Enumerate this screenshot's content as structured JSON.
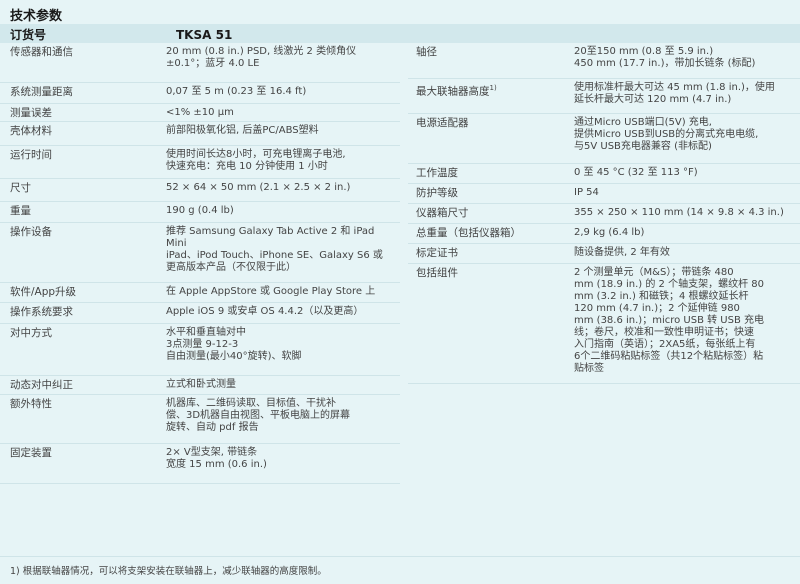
{
  "title": "技术参数",
  "header": {
    "key": "订货号",
    "value": "TKSA 51"
  },
  "left": [
    {
      "k": "传感器和通信",
      "v": "20 mm (0.8 in.) PSD, 线激光 2 类倾角仪\n±0.1°；蓝牙 4.0 LE",
      "h": 40
    },
    {
      "k": "系统测量距离",
      "v": "0,07 至 5 m (0.23 至 16.4 ft)",
      "h": 21
    },
    {
      "k": "测量误差",
      "v": "<1% ±10 µm",
      "h": 18
    },
    {
      "k": "壳体材料",
      "v": "前部阳极氧化铝, 后盖PC/ABS塑料",
      "h": 24
    },
    {
      "k": "运行时间",
      "v": "使用时间长达8小时，可充电锂离子电池,\n快速充电：充电 10 分钟使用 1 小时",
      "h": 33
    },
    {
      "k": "尺寸",
      "v": "52 × 64 × 50 mm (2.1 × 2.5 × 2 in.)",
      "h": 23
    },
    {
      "k": "重量",
      "v": "190 g (0.4 lb)",
      "h": 21
    },
    {
      "k": "操作设备",
      "v": "推荐 Samsung Galaxy Tab Active 2 和 iPad\nMini\niPad、iPod Touch、iPhone SE、Galaxy S6 或\n更高版本产品（不仅限于此）",
      "h": 60
    },
    {
      "k": "软件/App升级",
      "v": "在 Apple AppStore 或 Google Play Store 上",
      "h": 20
    },
    {
      "k": "操作系统要求",
      "v": "Apple iOS 9 或安卓 OS 4.4.2（以及更高）",
      "h": 21
    },
    {
      "k": "对中方式",
      "v": "水平和垂直轴对中\n3点测量 9-12-3\n自由测量(最小40°旋转)、软脚",
      "h": 52
    },
    {
      "k": "动态对中纠正",
      "v": "立式和卧式测量",
      "h": 19
    },
    {
      "k": "额外特性",
      "v": "机器库、二维码读取、目标值、干扰补\n偿、3D机器自由视图、平板电脑上的屏幕\n旋转、自动 pdf 报告",
      "h": 49
    },
    {
      "k": "固定装置",
      "v": "2× V型支架, 带链条\n宽度 15 mm (0.6 in.)",
      "h": 40
    }
  ],
  "right": [
    {
      "k": "轴径",
      "v": "20至150 mm (0.8 至 5.9 in.)\n450 mm (17.7 in.)，带加长链条 (标配)",
      "h": 36
    },
    {
      "k": "最大联轴器高度",
      "sup": "1)",
      "v": "使用标准杆最大可达 45 mm (1.8 in.)，使用\n延长杆最大可达 120 mm (4.7 in.)",
      "h": 35
    },
    {
      "k": "电源适配器",
      "v": "通过Micro USB端口(5V) 充电,\n提供Micro USB到USB的分离式充电电缆,\n与5V USB充电器兼容 (非标配)",
      "h": 50
    },
    {
      "k": "工作温度",
      "v": "0 至 45 °C (32 至 113 °F)",
      "h": 20
    },
    {
      "k": "防护等级",
      "v": "IP 54",
      "h": 20
    },
    {
      "k": "仪器箱尺寸",
      "v": "355 × 250 × 110 mm (14 × 9.8 × 4.3 in.)",
      "h": 20
    },
    {
      "k": "总重量（包括仪器箱）",
      "v": "2,9 kg (6.4 lb)",
      "h": 20
    },
    {
      "k": "标定证书",
      "v": "随设备提供, 2 年有效",
      "h": 20
    },
    {
      "k": "包括组件",
      "v": "2 个测量单元（M&S）；带链条 480\nmm (18.9 in.) 的 2 个轴支架，螺纹杆 80\nmm (3.2 in.) 和磁铁；4 根螺纹延长杆\n120 mm (4.7 in.)；2 个延伸链 980\nmm (38.6 in.)；micro USB 转 USB 充电\n线；卷尺，校准和一致性申明证书；快速\n入门指南（英语）；2XA5纸，每张纸上有\n6个二维码粘贴标签（共12个粘贴标签）粘\n贴标签",
      "h": 120
    }
  ],
  "footnote": "1) 根据联轴器情况，可以将支架安装在联轴器上，减少联轴器的高度限制。"
}
